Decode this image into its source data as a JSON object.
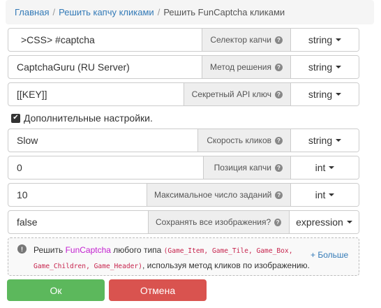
{
  "breadcrumb": {
    "items": [
      "Главная",
      "Решить капчу кликами"
    ],
    "current": "Решить FunCaptcha кликами",
    "separator": "/"
  },
  "fields": [
    {
      "value": ">CSS> #captcha",
      "label": "Селектор капчи",
      "type": "string"
    },
    {
      "value": "CaptchaGuru (RU Server)",
      "label": "Метод решения",
      "type": "string"
    },
    {
      "value": "[[KEY]]",
      "label": "Секретный API ключ",
      "type": "string"
    },
    {
      "value": "Slow",
      "label": "Скорость кликов",
      "type": "string"
    },
    {
      "value": "0",
      "label": "Позиция капчи",
      "type": "int"
    },
    {
      "value": "10",
      "label": "Максимальное число заданий",
      "type": "int"
    },
    {
      "value": "false",
      "label": "Сохранять все изображения?",
      "type": "expression"
    }
  ],
  "advanced": {
    "label": "Дополнительные настройки.",
    "checked": true
  },
  "info": {
    "prefix": "Решить ",
    "highlight": "FunCaptcha",
    "middle": " любого типа ",
    "code": "(Game_Item, Game_Tile, Game_Box, Game_Children, Game_Header)",
    "suffix": ", используя метод кликов по изображению.",
    "more": "+ Больше"
  },
  "buttons": {
    "ok": "Ок",
    "cancel": "Отмена"
  },
  "colors": {
    "ok": "#5cb85c",
    "cancel": "#d9534f",
    "link": "#337ab7",
    "highlight": "#c21ecf"
  }
}
